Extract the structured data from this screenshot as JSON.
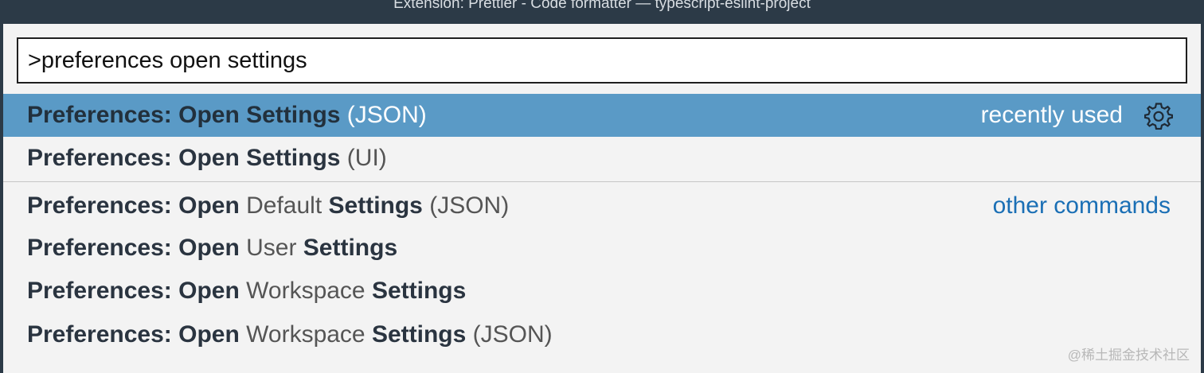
{
  "window": {
    "title": "Extension: Prettier - Code formatter — typescript-eslint-project"
  },
  "search": {
    "value": ">preferences open settings"
  },
  "items": [
    {
      "bold1": "Preferences: Open Settings",
      "normal1": " (JSON)",
      "right_label": "recently used",
      "right_icon": "gear-icon"
    },
    {
      "bold1": "Preferences: Open Settings",
      "normal1": " (UI)"
    },
    {
      "bold1": "Preferences: Open",
      "normal1": " Default ",
      "bold2": "Settings",
      "normal2": " (JSON)",
      "right_label": "other commands"
    },
    {
      "bold1": "Preferences: Open",
      "normal1": " User ",
      "bold2": "Settings"
    },
    {
      "bold1": "Preferences: Open",
      "normal1": " Workspace ",
      "bold2": "Settings"
    },
    {
      "bold1": "Preferences: Open",
      "normal1": " Workspace ",
      "bold2": "Settings",
      "normal2": " (JSON)"
    }
  ],
  "watermark": "@稀土掘金技术社区",
  "colors": {
    "selection": "#5a9ac6",
    "titlebar": "#2c3a47",
    "link": "#1a6fb5"
  }
}
